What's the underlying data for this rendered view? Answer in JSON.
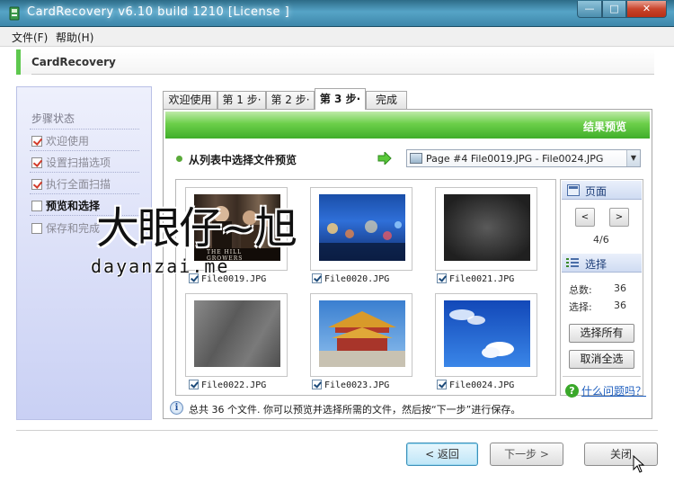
{
  "window": {
    "title": "CardRecovery v6.10 build 1210  [License ]",
    "controls": {
      "minimize": "—",
      "maximize": "□",
      "close": "✕"
    }
  },
  "menu": [
    "文件(F)",
    "帮助(H)"
  ],
  "header": {
    "title": "CardRecovery"
  },
  "sidebar": {
    "title": "步骤状态",
    "steps": [
      {
        "label": "欢迎使用",
        "checked": true
      },
      {
        "label": "设置扫描选项",
        "checked": true
      },
      {
        "label": "执行全面扫描",
        "checked": true
      },
      {
        "label": "预览和选择",
        "checked": false,
        "active": true
      },
      {
        "label": "保存和完成",
        "checked": false
      }
    ]
  },
  "tabs": [
    "欢迎使用",
    "第 1 步·",
    "第 2 步·",
    "第 3 步·",
    "完成"
  ],
  "selected_tab": 3,
  "panel": {
    "banner_title": "结果预览",
    "select_label": "从列表中选择文件预览",
    "page_dropdown": "Page #4    File0019.JPG - File0024.JPG",
    "files": [
      {
        "name": "File0019.JPG",
        "checked": true
      },
      {
        "name": "File0020.JPG",
        "checked": true
      },
      {
        "name": "File0021.JPG",
        "checked": true
      },
      {
        "name": "File0022.JPG",
        "checked": true
      },
      {
        "name": "File0023.JPG",
        "checked": true
      },
      {
        "name": "File0024.JPG",
        "checked": true
      }
    ],
    "poster_text": "THE HILL GROWERS",
    "info_text": "总共 36 个文件. 你可以预览并选择所需的文件，然后按“下一步”进行保存。"
  },
  "right_pane": {
    "page_header": "页面",
    "prev": "<",
    "next": ">",
    "page_counter": "4/6",
    "select_header": "选择",
    "total_label": "总数:",
    "total_value": "36",
    "selected_label": "选择:",
    "selected_value": "36",
    "select_all": "选择所有",
    "deselect_all": "取消全选",
    "help_link": "什么问题吗？"
  },
  "watermark": {
    "cn": "大眼仔~旭",
    "en": "dayanzai.me"
  },
  "buttons": {
    "back": "< 返回",
    "next": "下一步 >",
    "close": "关闭"
  }
}
